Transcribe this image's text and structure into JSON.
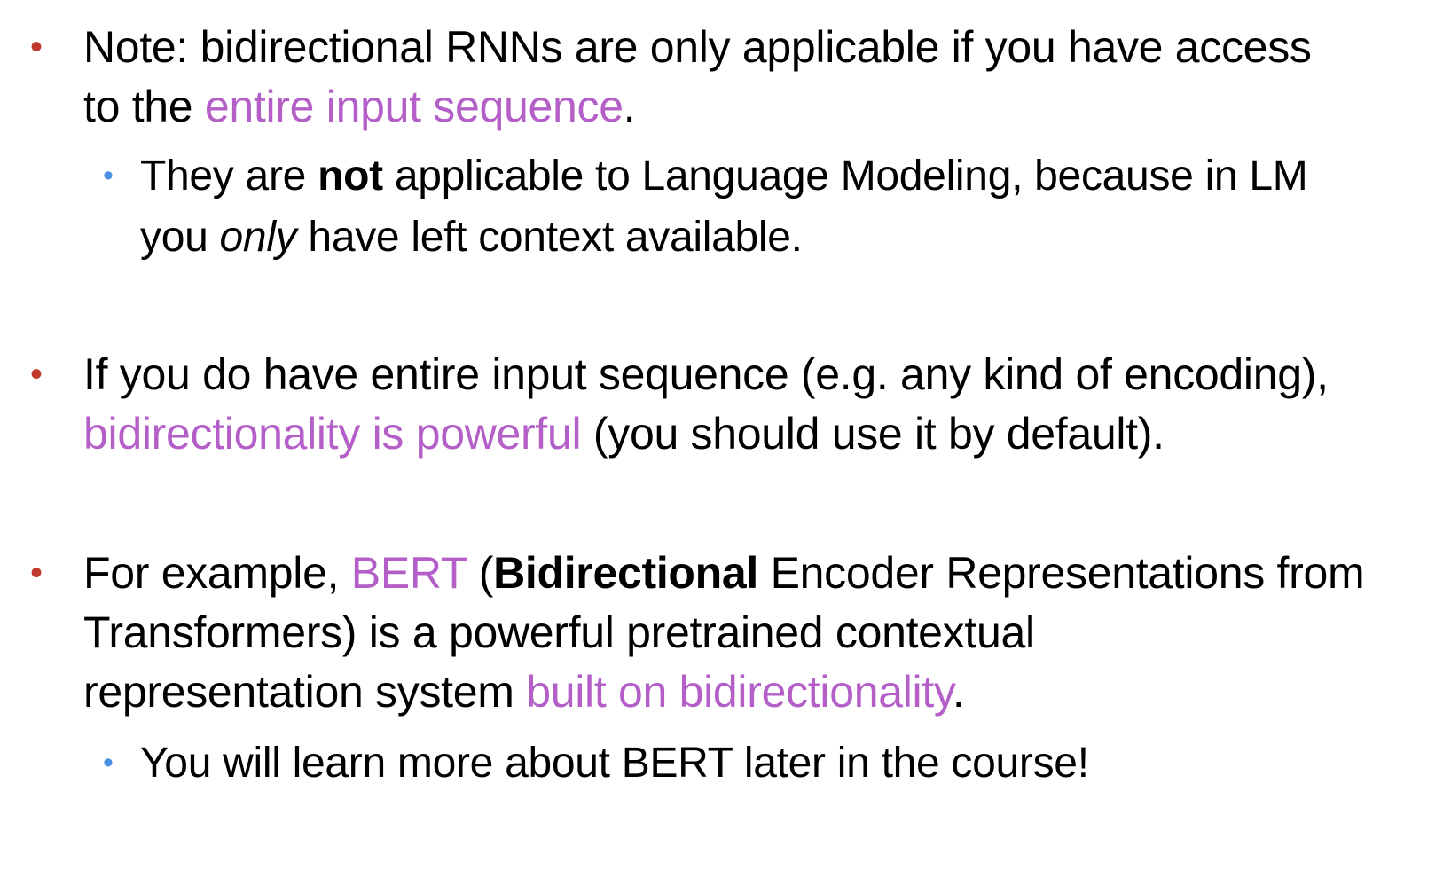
{
  "colors": {
    "main_bullet": "#c0392b",
    "sub_bullet": "#4a90e2",
    "highlight": "#b45fc8",
    "text": "#000000"
  },
  "bullets": [
    {
      "marker": "•",
      "line1": "Note: bidirectional RNNs are only applicable if you have access",
      "line2_pre": "to the ",
      "line2_hl": "entire input sequence",
      "line2_post": ".",
      "sub": {
        "marker": "•",
        "pre": "They are ",
        "bold": "not",
        "post": " applicable to Language Modeling, because in LM",
        "line2_pre": "you ",
        "line2_italic": "only",
        "line2_post": " have left context available."
      }
    },
    {
      "marker": "•",
      "line1": "If you do have entire input sequence (e.g. any kind of encoding),",
      "line2_hl": "bidirectionality is powerful",
      "line2_post": " (you should use it by default)."
    },
    {
      "marker": "•",
      "line1_pre": "For example, ",
      "line1_hl": "BERT",
      "line1_open": " (",
      "line1_bold": "Bidirectional",
      "line1_post": " Encoder Representations from",
      "line2": "Transformers) is a powerful pretrained contextual",
      "line3_pre": "representation system ",
      "line3_hl": "built on bidirectionality",
      "line3_post": ".",
      "sub": {
        "marker": "•",
        "text": "You will learn more about BERT later in the course!"
      }
    }
  ]
}
